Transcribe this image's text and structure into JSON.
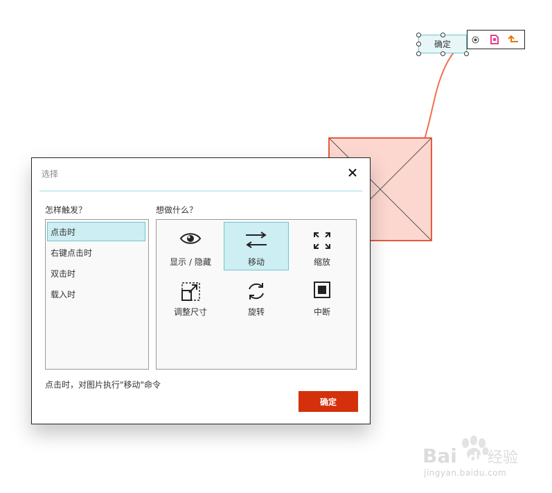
{
  "canvas": {
    "button_label": "确定",
    "colors": {
      "accent": "#6cc6cf",
      "shape_fill": "#fcd7d0",
      "shape_border": "#e85a3c",
      "connector": "#f36e4e",
      "toolbar_pink": "#e83e8c",
      "toolbar_orange": "#e8740c"
    },
    "toolbar_icons": [
      "target-icon",
      "page-icon",
      "turn-arrow-icon"
    ]
  },
  "dialog": {
    "title": "选择",
    "trigger_heading": "怎样触发？",
    "action_heading": "想做什么？",
    "triggers": [
      {
        "label": "点击时",
        "selected": true
      },
      {
        "label": "右键点击时",
        "selected": false
      },
      {
        "label": "双击时",
        "selected": false
      },
      {
        "label": "载入时",
        "selected": false
      }
    ],
    "actions": [
      {
        "label": "显示 / 隐藏",
        "icon": "eye-icon",
        "selected": false
      },
      {
        "label": "移动",
        "icon": "move-arrows-icon",
        "selected": true
      },
      {
        "label": "缩放",
        "icon": "zoom-arrows-icon",
        "selected": false
      },
      {
        "label": "调整尺寸",
        "icon": "resize-icon",
        "selected": false
      },
      {
        "label": "旋转",
        "icon": "rotate-icon",
        "selected": false
      },
      {
        "label": "中断",
        "icon": "stop-icon",
        "selected": false
      }
    ],
    "summary": "点击时，对图片执行\"移动\"命令",
    "ok_label": "确定",
    "ok_color": "#d4300c"
  },
  "watermark": {
    "brand": "Bai du 经验",
    "url": "jingyan.baidu.com"
  }
}
